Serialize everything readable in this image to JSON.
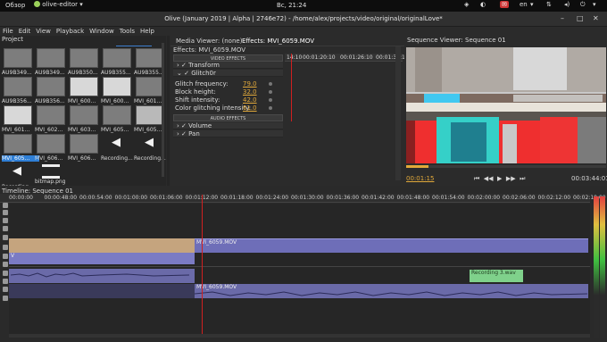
{
  "system_bar": {
    "overview": "Обзор",
    "app": "olive-editor",
    "clock": "Вс, 21:24",
    "lang": "en"
  },
  "window": {
    "title": "Olive (January 2019 | Alpha | 2746e72) - /home/alex/projects/video/original/originalLove*"
  },
  "menu": [
    "File",
    "Edit",
    "View",
    "Playback",
    "Window",
    "Tools",
    "Help"
  ],
  "project": {
    "title": "Project",
    "items": [
      {
        "label": "AU9B349...",
        "kind": "thumb"
      },
      {
        "label": "AU9B349...",
        "kind": "thumb"
      },
      {
        "label": "AU9B350...",
        "kind": "thumb"
      },
      {
        "label": "AU9B355...",
        "kind": "thumb"
      },
      {
        "label": "AU9B355...",
        "kind": "thumb"
      },
      {
        "label": "AU9B356...",
        "kind": "thumb"
      },
      {
        "label": "AU9B356...",
        "kind": "thumb"
      },
      {
        "label": "MVI_600...",
        "kind": "white"
      },
      {
        "label": "MVI_600...",
        "kind": "white"
      },
      {
        "label": "MVI_601...",
        "kind": "thumb"
      },
      {
        "label": "MVI_601...",
        "kind": "white"
      },
      {
        "label": "MVI_602...",
        "kind": "thumb"
      },
      {
        "label": "MVI_603...",
        "kind": "thumb"
      },
      {
        "label": "MVI_605...",
        "kind": "thumb"
      },
      {
        "label": "MVI_605...",
        "kind": "light"
      },
      {
        "label": "MVI_605...",
        "kind": "thumb",
        "selected": true
      },
      {
        "label": "MVI_606...",
        "kind": "thumb"
      },
      {
        "label": "MVI_606...",
        "kind": "thumb"
      },
      {
        "label": "Recording...",
        "kind": "audio"
      },
      {
        "label": "Recording...",
        "kind": "audio"
      },
      {
        "label": "Recording...",
        "kind": "audio"
      },
      {
        "label": "bitmap.png",
        "kind": "bitmap"
      }
    ]
  },
  "effects": {
    "tabs": [
      "Media Viewer: (none)",
      "Effects: MVI_6059.MOV"
    ],
    "subtitle": "Effects: MVI_6059.MOV",
    "video_header": "VIDEO EFFECTS",
    "audio_header": "AUDIO EFFECTS",
    "video_effects": [
      "Transform",
      "Glitch0r"
    ],
    "params": [
      {
        "name": "Glitch frequency:",
        "value": "79.0"
      },
      {
        "name": "Block height:",
        "value": "32.0"
      },
      {
        "name": "Shift intensity:",
        "value": "42.0"
      },
      {
        "name": "Color glitching intensity:",
        "value": "61.0"
      }
    ],
    "audio_effects": [
      "Volume",
      "Pan"
    ],
    "ruler": [
      "14:10",
      "00:01:20:10",
      "00:01:26:10",
      "00:01:32:1"
    ]
  },
  "viewer": {
    "title": "Sequence Viewer: Sequence 01",
    "current": "00:01:15",
    "total": "00:03:44:01"
  },
  "timeline": {
    "title": "Timeline: Sequence 01",
    "ruler": [
      "00:00:00",
      "00:00:48:00",
      "00:00:54:00",
      "00:01:00:00",
      "00:01:06:00",
      "00:01:12:00",
      "00:01:18:00",
      "00:01:24:00",
      "00:01:30:00",
      "00:01:36:00",
      "00:01:42:00",
      "00:01:48:00",
      "00:01:54:00",
      "00:02:00:00",
      "00:02:06:00",
      "00:02:12:00",
      "00:02:18:00"
    ],
    "clips": {
      "video_main": "MVI_6059.MOV",
      "video_left": "V",
      "audio_rec": "Recording 3.wav",
      "audio_main": "MVI_6059.MOV"
    }
  },
  "colors": {
    "accent_orange": "#e2a93a",
    "video_clip": "#7b7bc4",
    "video_clip_tan": "#c5a47e",
    "audio_clip_green": "#7fd18b",
    "selection": "#2f7fd6",
    "playhead": "#d02020"
  }
}
